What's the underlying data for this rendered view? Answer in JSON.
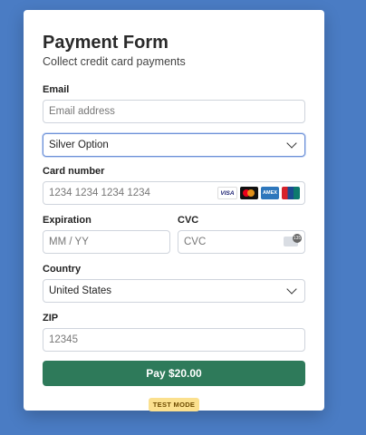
{
  "form": {
    "title": "Payment Form",
    "subtitle": "Collect credit card payments"
  },
  "email": {
    "label": "Email",
    "placeholder": "Email address"
  },
  "plan": {
    "selected": "Silver Option"
  },
  "card": {
    "label": "Card number",
    "placeholder": "1234 1234 1234 1234",
    "brands": [
      "VISA",
      "mastercard",
      "AMEX",
      "UnionPay"
    ]
  },
  "expiration": {
    "label": "Expiration",
    "placeholder": "MM / YY"
  },
  "cvc": {
    "label": "CVC",
    "placeholder": "CVC",
    "icon_text": "135"
  },
  "country": {
    "label": "Country",
    "selected": "United States"
  },
  "zip": {
    "label": "ZIP",
    "placeholder": "12345"
  },
  "pay_button": {
    "label": "Pay $20.00"
  },
  "badge": {
    "label": "TEST MODE"
  },
  "colors": {
    "background": "#4a7cc4",
    "pay_button": "#2e7a5a",
    "badge": "#fbe08e"
  }
}
